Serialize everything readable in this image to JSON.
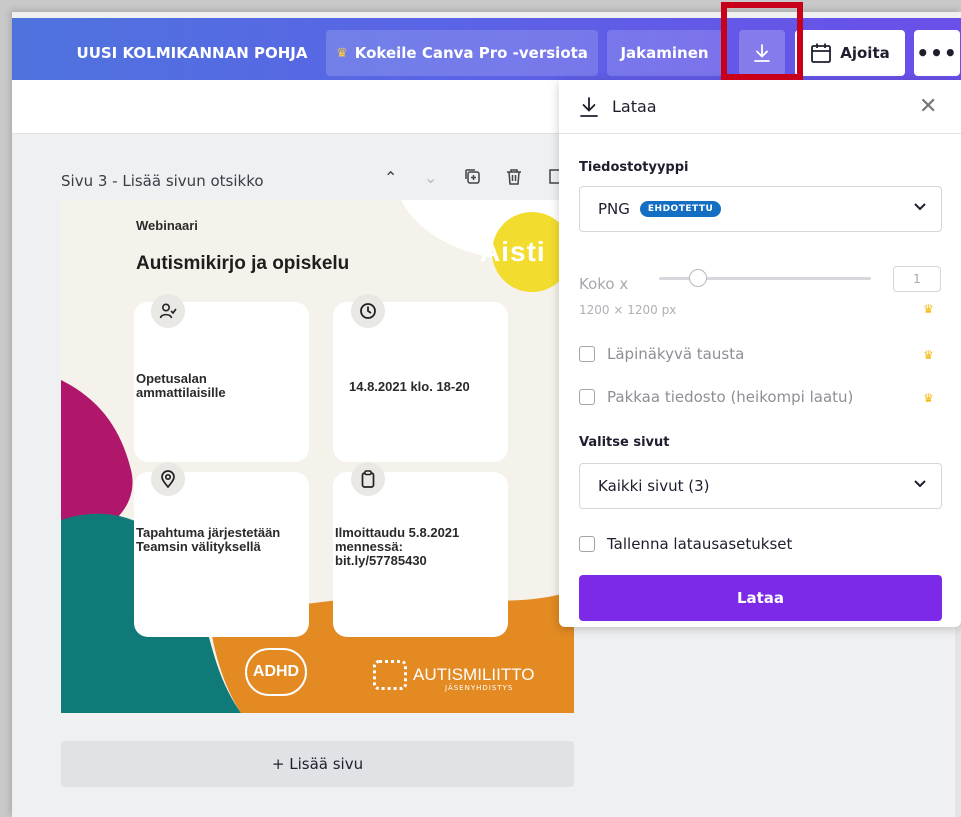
{
  "topbar": {
    "title": "UUSI KOLMIKANNAN POHJA",
    "pro_label": "Kokeile Canva Pro -versiota",
    "share_label": "Jakaminen",
    "download_icon": "download-icon",
    "schedule_label": "Ajoita",
    "more_label": "•••"
  },
  "page": {
    "label": "Sivu 3 - Lisää sivun otsikko",
    "add_page_label": "+ Lisää sivu"
  },
  "design": {
    "small_title": "Webinaari",
    "title": "Autismikirjo ja opiskelu",
    "logo_text": "Aisti",
    "cards": [
      {
        "icon": "user-check-icon",
        "text": "Opetusalan ammattilaisille"
      },
      {
        "icon": "clock-icon",
        "text": "14.8.2021 klo. 18-20"
      },
      {
        "icon": "location-icon",
        "text": "Tapahtuma järjestetään Teamsin välityksellä"
      },
      {
        "icon": "clipboard-icon",
        "text": "Ilmoittaudu 5.8.2021 mennessä: bit.ly/57785430"
      }
    ],
    "adhd_logo": "ADHD",
    "autismi_logo": "AUTISMILIITTO",
    "autismi_sub": "JÄSENYHDISTYS",
    "colors": {
      "magenta": "#b0176b",
      "teal": "#0f7a78",
      "orange": "#e38a22",
      "yellow": "#f2dd2e"
    }
  },
  "download_panel": {
    "title": "Lataa",
    "file_type_label": "Tiedostotyyppi",
    "file_type_value": "PNG",
    "file_type_badge": "EHDOTETTU",
    "size_label": "Koko x",
    "size_value": "1",
    "size_scale_fraction": 0.15,
    "dimensions": "1200 × 1200 px",
    "transparent_bg": "Läpinäkyvä tausta",
    "compress": "Pakkaa tiedosto (heikompi laatu)",
    "pages_label": "Valitse sivut",
    "pages_value": "Kaikki sivut (3)",
    "save_settings": "Tallenna latausasetukset",
    "download_button": "Lataa",
    "accent": "#7d2ae8"
  }
}
